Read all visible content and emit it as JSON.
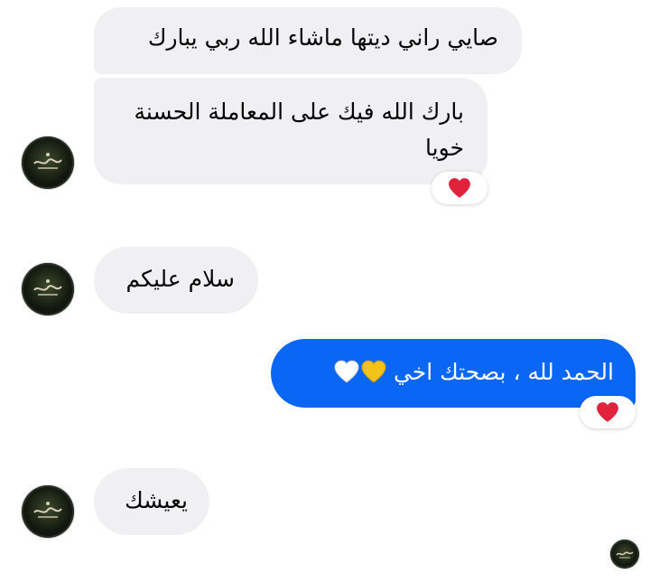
{
  "messages": [
    {
      "id": "m1",
      "direction": "incoming",
      "text": "صايي راني ديتها ماشاء الله ربي يبارك"
    },
    {
      "id": "m2",
      "direction": "incoming",
      "lines": [
        "بارك الله فيك على المعاملة الحسنة",
        "خويا"
      ],
      "reaction": "heart"
    },
    {
      "id": "m3",
      "direction": "incoming",
      "text": "سلام عليكم"
    },
    {
      "id": "m4",
      "direction": "outgoing",
      "text": "الحمد لله ، بصحتك اخي",
      "emojis": [
        "yellow-heart",
        "white-heart"
      ],
      "reaction": "heart"
    },
    {
      "id": "m5",
      "direction": "incoming",
      "text": "يعيشك"
    }
  ],
  "colors": {
    "incoming_bubble": "#f0f0f3",
    "outgoing_bubble": "#0a66f5",
    "reaction_heart": "#e0223a"
  },
  "icons": {
    "avatar": "contact-avatar-icon",
    "read_receipt": "read-receipt-avatar-icon",
    "reaction": "red-heart-icon"
  }
}
